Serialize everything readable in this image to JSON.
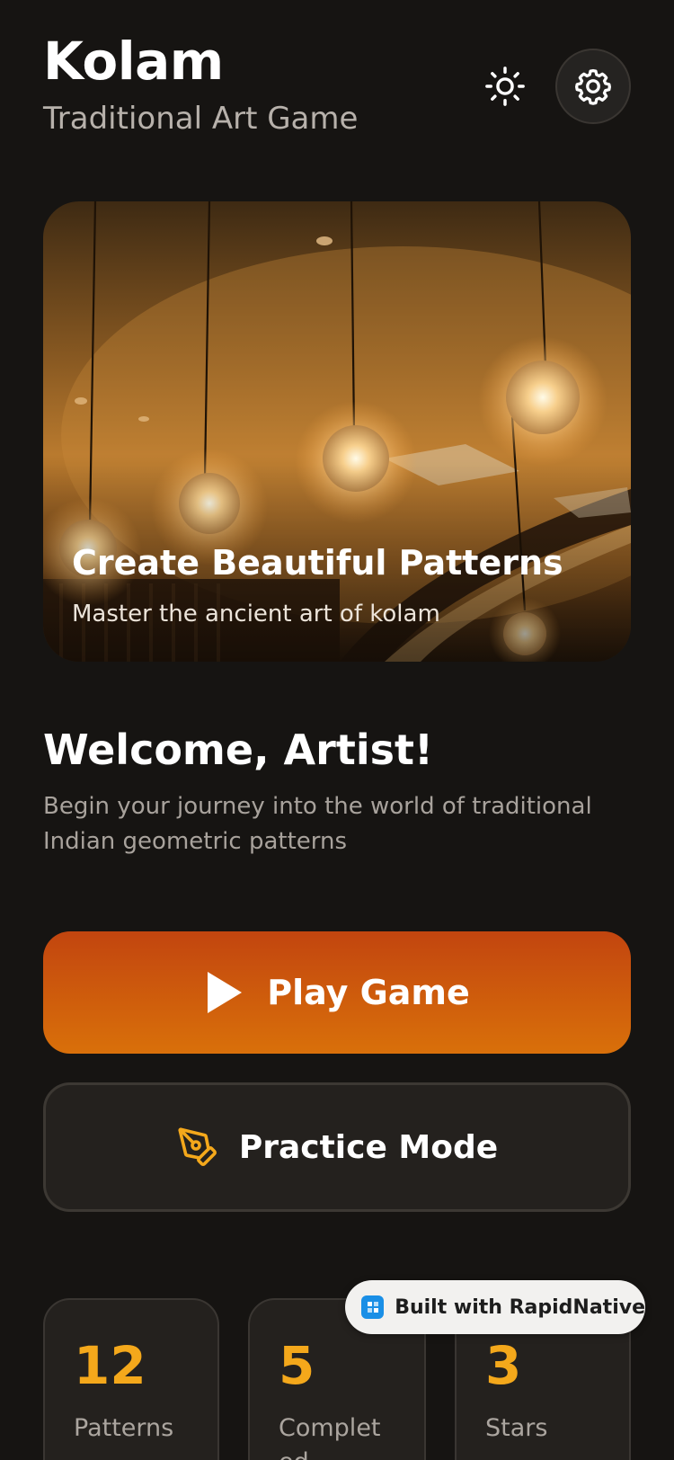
{
  "header": {
    "title": "Kolam",
    "subtitle": "Traditional Art Game",
    "theme_icon": "sun-icon",
    "settings_icon": "gear-icon"
  },
  "hero": {
    "title": "Create Beautiful Patterns",
    "subtitle": "Master the ancient art of kolam",
    "image": "pendant-lights-photo"
  },
  "welcome": {
    "title": "Welcome, Artist!",
    "text": "Begin your journey into the world of traditional Indian geometric patterns"
  },
  "actions": {
    "play_label": "Play Game",
    "play_icon": "play-icon",
    "practice_label": "Practice Mode",
    "practice_icon": "pen-tool-icon"
  },
  "stats": [
    {
      "value": "12",
      "label": "Patterns"
    },
    {
      "value": "5",
      "label": "Completed"
    },
    {
      "value": "3",
      "label": "Stars"
    }
  ],
  "badge": {
    "text": "Built with RapidNative"
  },
  "colors": {
    "background": "#161412",
    "accent": "#f4a81b",
    "play_gradient_top": "#c2450f",
    "play_gradient_bottom": "#d9700a",
    "practice_icon": "#f4a81b"
  }
}
